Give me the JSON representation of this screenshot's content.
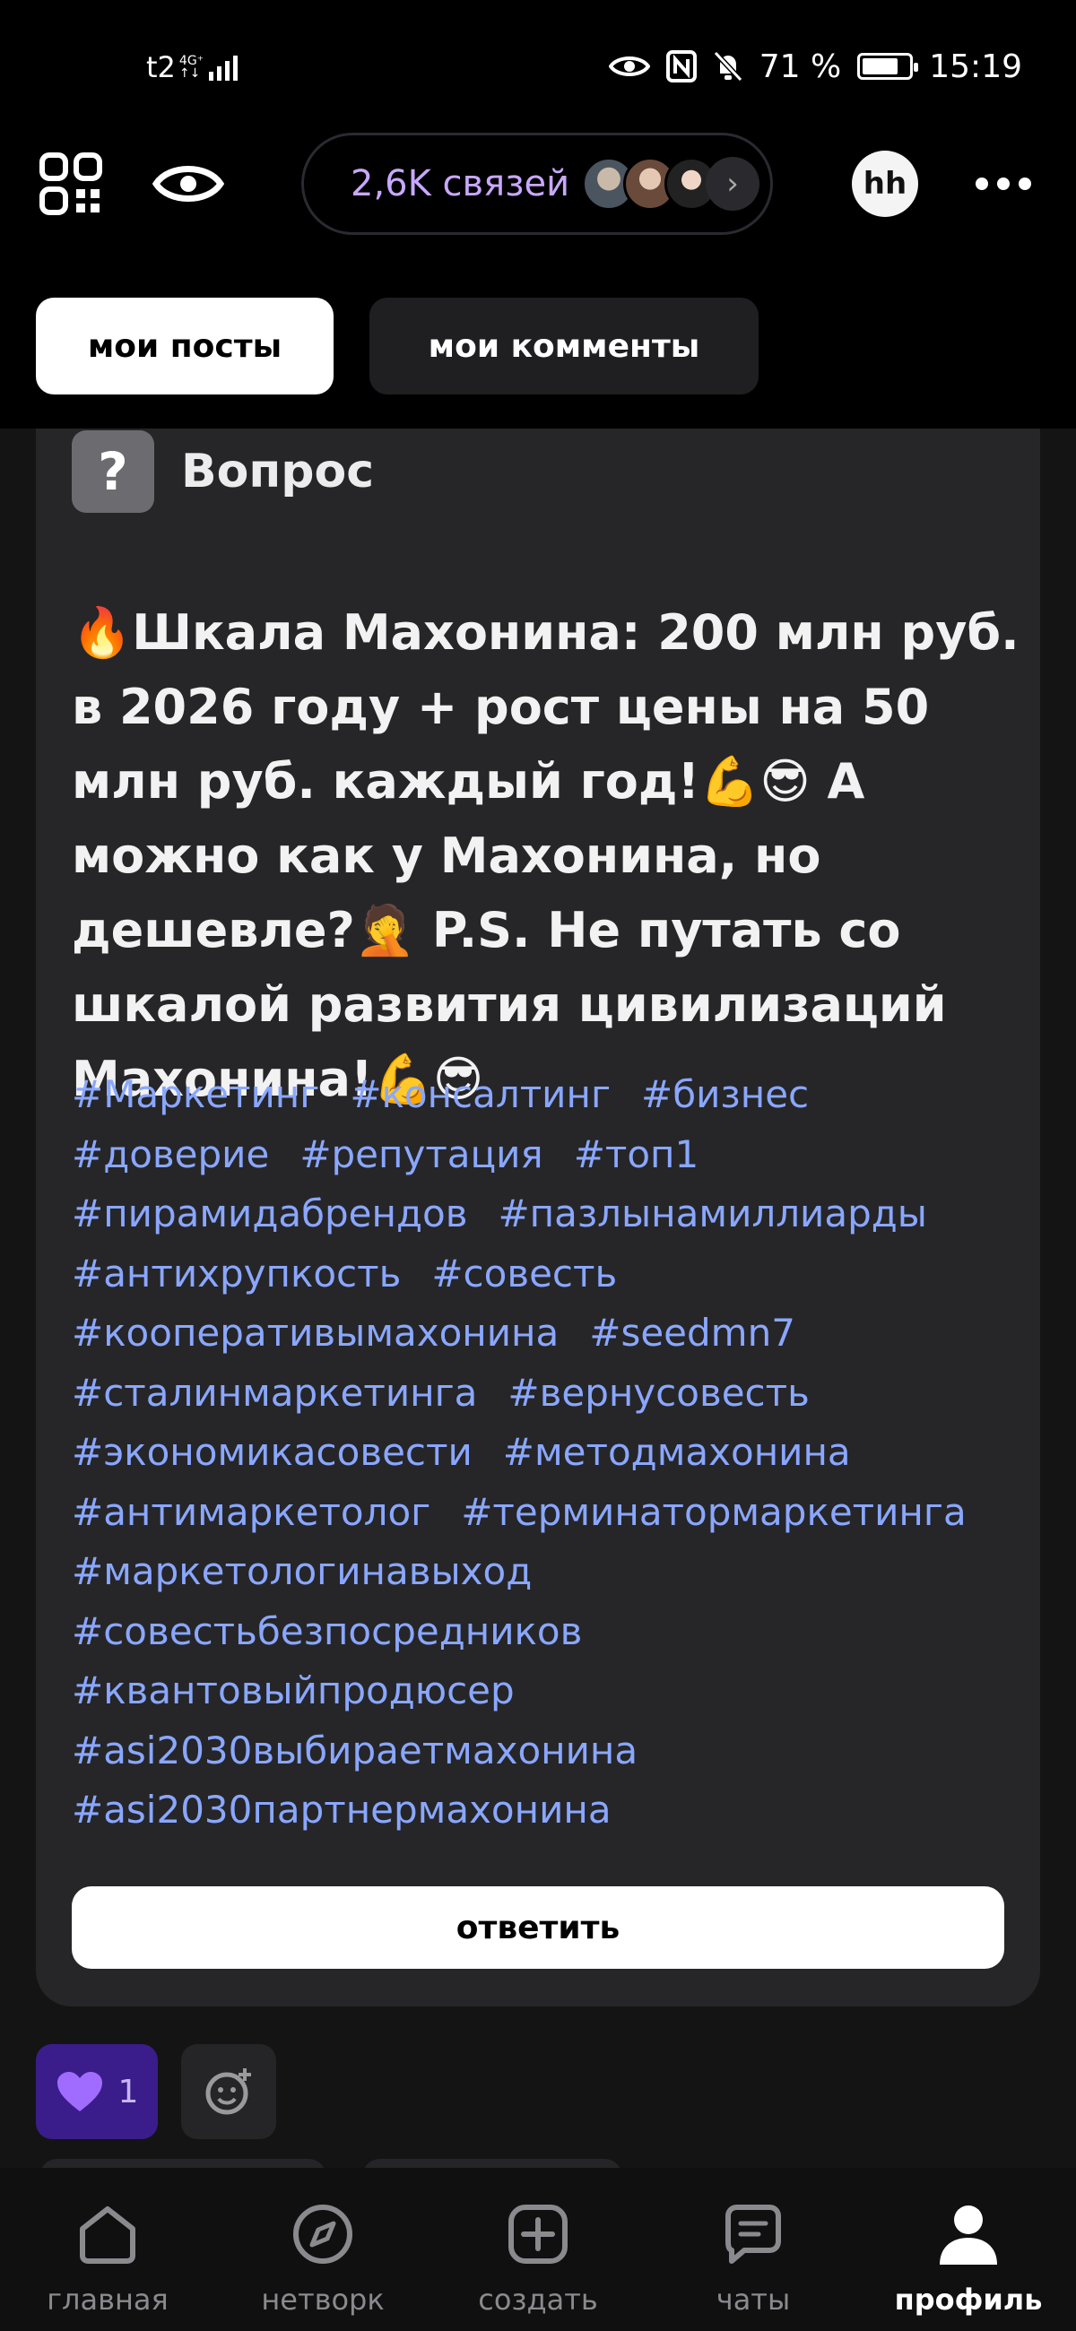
{
  "status_bar": {
    "carrier": "t2",
    "network_top": "4G⁺",
    "network_bottom": "↑↓",
    "battery": "71 %",
    "time": "15:19"
  },
  "header": {
    "connections_label": "2,6K связей",
    "profile_initials": "hh"
  },
  "tabs": [
    {
      "label": "мои посты",
      "active": true
    },
    {
      "label": "мои комменты",
      "active": false
    }
  ],
  "post": {
    "type_label": "Вопрос",
    "text": "🔥Шкала Махонина: 200 млн руб. в 2026 году + рост цены на 50 млн руб. каждый год!💪😎 А можно как у Махонина, но дешевле?🤦 P.S. Не путать со шкалой развития цивилизаций Махонина!💪😎",
    "hashtags": [
      "#Маркетинг",
      "#консалтинг",
      "#бизнес",
      "#доверие",
      "#репутация",
      "#топ1",
      "#пирамидабрендов",
      "#пазлынамиллиарды",
      "#антихрупкость",
      "#совесть",
      "#кооперативымахонина",
      "#seedmn7",
      "#сталинмаркетинга",
      "#вернусовесть",
      "#экономикасовести",
      "#методмахонина",
      "#антимаркетолог",
      "#терминатормаркетинга",
      "#маркетологинавыход",
      "#совестьбезпосредников",
      "#квантовыйпродюсер",
      "#asi2030выбираетмахонина",
      "#asi2030партнермахонина"
    ],
    "reply_label": "ответить",
    "reaction_count": "1"
  },
  "bottom_nav": [
    {
      "label": "главная",
      "icon": "home-icon",
      "active": false
    },
    {
      "label": "нетворк",
      "icon": "compass-icon",
      "active": false
    },
    {
      "label": "создать",
      "icon": "plus-square-icon",
      "active": false
    },
    {
      "label": "чаты",
      "icon": "chat-icon",
      "active": false
    },
    {
      "label": "профиль",
      "icon": "profile-icon",
      "active": true
    }
  ],
  "colors": {
    "accent_purple": "#c8a8ff",
    "hashtag_blue": "#8aa7ff",
    "card_bg": "#262628"
  }
}
